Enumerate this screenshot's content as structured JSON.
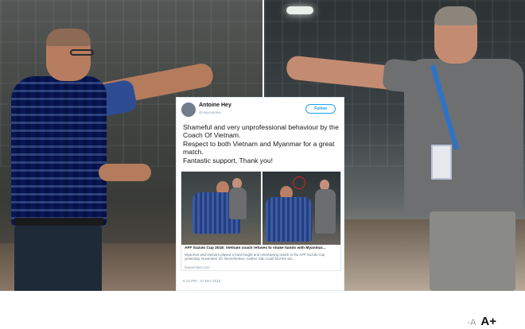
{
  "tweet": {
    "author_name": "Antoine Hey",
    "author_handle": "@HeyAntoine",
    "follow_label": "Follow",
    "text_lines": [
      "Shameful and very unprofessional  behaviour by the Coach Of Vietnam.",
      "Respect to both Vietnam and Myanmar for a great match.",
      "Fantastic support, Thank you!"
    ],
    "link_card": {
      "title": "AFF Suzuki Cup 2018: Vietnam coach refuses to shake hands with Myanmar...",
      "description": "Myanmar and Vietnam played a hard-fought and entertaining match in the AFF Suzuki Cup yesterday, November 20. Nevertheless, neither side could find the win...",
      "domain": "livepremiere.com"
    },
    "timestamp": "6:12 PM - 21 Nov 2018"
  },
  "font_controls": {
    "decrease_label": "-A",
    "increase_label": "A+"
  },
  "colors": {
    "follow_blue": "#1da1f2",
    "highlight_circle": "#d8251d"
  }
}
